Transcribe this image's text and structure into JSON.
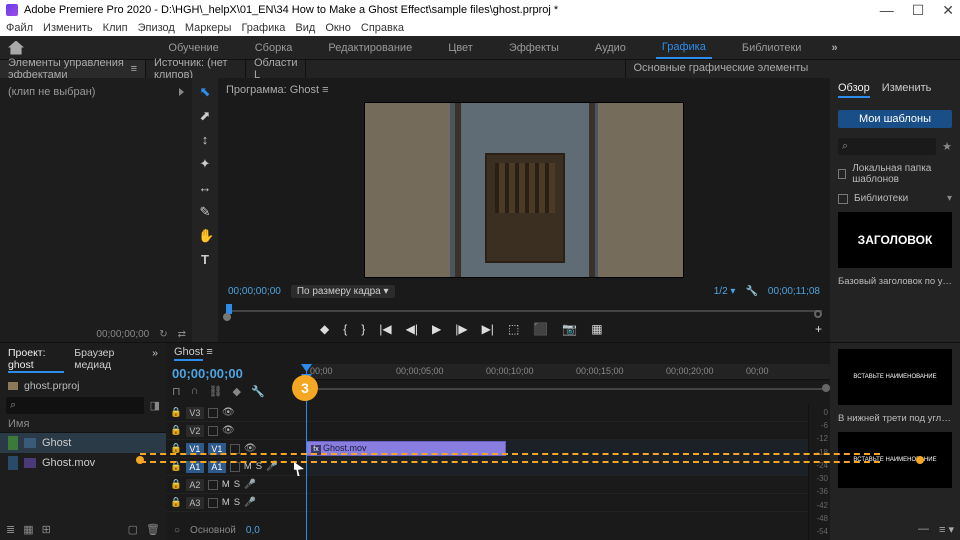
{
  "titlebar": {
    "title": "Adobe Premiere Pro 2020 - D:\\HGH\\_helpX\\01_EN\\34 How to Make a Ghost Effect\\sample files\\ghost.prproj *"
  },
  "menu": [
    "Файл",
    "Изменить",
    "Клип",
    "Эпизод",
    "Маркеры",
    "Графика",
    "Вид",
    "Окно",
    "Справка"
  ],
  "workspace": {
    "tabs": [
      "Обучение",
      "Сборка",
      "Редактирование",
      "Цвет",
      "Эффекты",
      "Аудио",
      "Графика",
      "Библиотеки"
    ],
    "active": 6
  },
  "strip": {
    "effect_controls": "Элементы управления эффектами",
    "source": "Источник: (нет клипов)",
    "regions": "Области L"
  },
  "left": {
    "clip_none": "(клип не выбран)",
    "timecode": "00;00;00;00"
  },
  "program": {
    "title": "Программа: Ghost",
    "tc_left": "00;00;00;00",
    "fit": "По размеру кадра",
    "ratio": "1/2",
    "tc_right": "00;00;11;08"
  },
  "eg": {
    "title": "Основные графические элементы",
    "tabs": [
      "Обзор",
      "Изменить"
    ],
    "my_templates": "Мои шаблоны",
    "search_icon": "⌕",
    "local_folder": "Локальная папка шаблонов",
    "libraries": "Библиотеки",
    "t1": "ЗАГОЛОВОК",
    "t1_label": "Базовый заголовок по умолч…",
    "t2": "ВСТАВЬТЕ НАИМЕНОВАНИЕ",
    "t2_label": "В нижней трети под углом",
    "t3": "ВСТАВЬТЕ НАИМЕНОВАНИЕ"
  },
  "project": {
    "tabs": [
      "Проект: ghost",
      "Браузер медиад"
    ],
    "file": "ghost.prproj",
    "search_icon": "⌕",
    "col_name": "Имя",
    "items": [
      {
        "name": "Ghost"
      },
      {
        "name": "Ghost.mov"
      }
    ]
  },
  "timeline": {
    "seq": "Ghost",
    "tc": "00;00;00;00",
    "ruler": [
      "00;00",
      "00;00;05;00",
      "00;00;10;00",
      "00;00;15;00",
      "00;00;20;00",
      "00;00"
    ],
    "tracks_v": [
      "V3",
      "V2",
      "V1"
    ],
    "tracks_a": [
      "A1",
      "A2",
      "A3"
    ],
    "clip": "Ghost.mov",
    "main_label": "Основной",
    "main_val": "0,0",
    "marker": "3",
    "meter": [
      0,
      -6,
      -12,
      -18,
      -24,
      -30,
      -36,
      -42,
      -48,
      -54
    ]
  }
}
